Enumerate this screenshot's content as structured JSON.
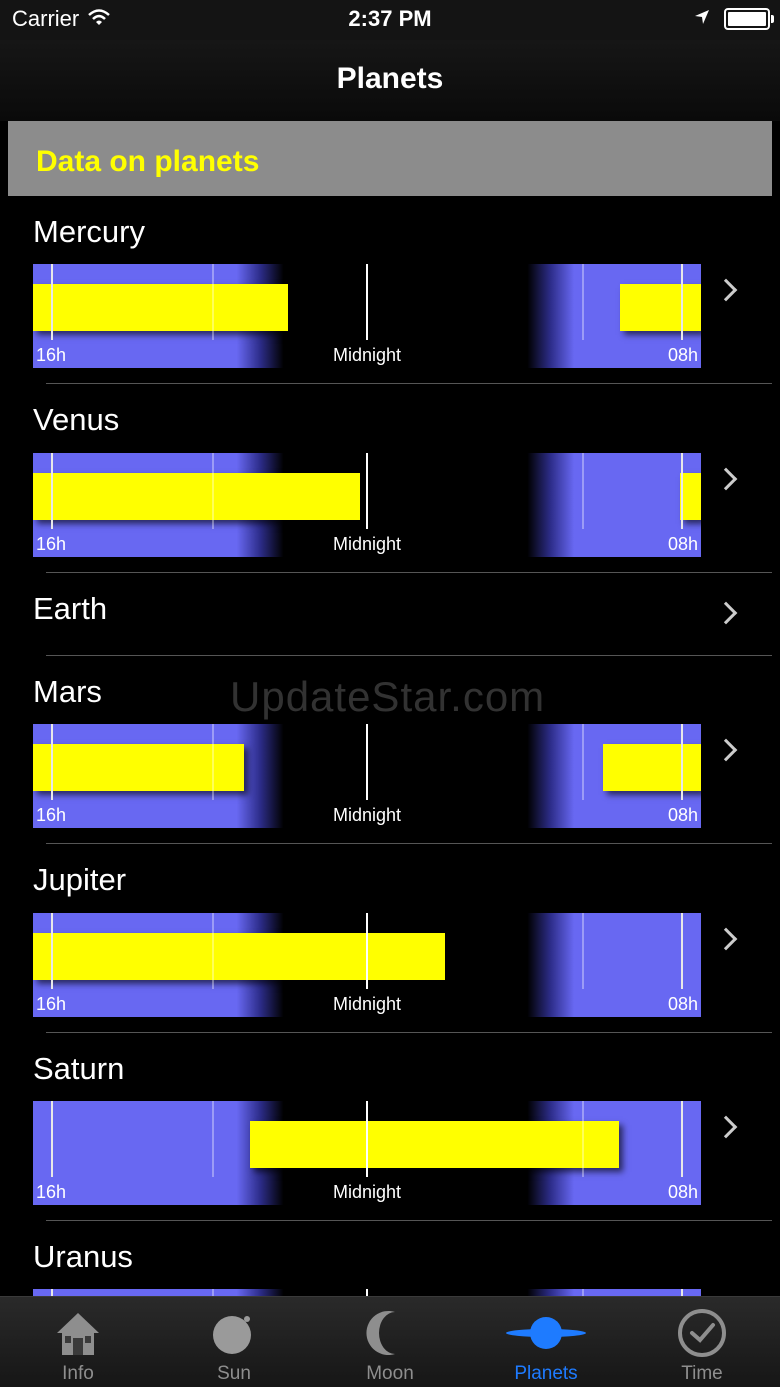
{
  "status_bar": {
    "carrier": "Carrier",
    "time": "2:37 PM"
  },
  "nav": {
    "title": "Planets"
  },
  "section": {
    "title": "Data on planets"
  },
  "timeline_labels": {
    "left": "16h",
    "middle": "Midnight",
    "right": "08h"
  },
  "colors": {
    "accent_yellow": "#ffff00",
    "sky_blue": "#6868f2",
    "tab_active": "#1e7bff"
  },
  "planets": [
    {
      "name": "Mercury",
      "has_chart": true,
      "visibility": [
        [
          0.0,
          0.382
        ],
        [
          0.878,
          1.0
        ]
      ]
    },
    {
      "name": "Venus",
      "has_chart": true,
      "visibility": [
        [
          0.0,
          0.49
        ],
        [
          0.969,
          1.0
        ]
      ]
    },
    {
      "name": "Earth",
      "has_chart": false,
      "visibility": []
    },
    {
      "name": "Mars",
      "has_chart": true,
      "visibility": [
        [
          0.0,
          0.316
        ],
        [
          0.853,
          1.0
        ]
      ]
    },
    {
      "name": "Jupiter",
      "has_chart": true,
      "visibility": [
        [
          0.0,
          0.617
        ]
      ]
    },
    {
      "name": "Saturn",
      "has_chart": true,
      "visibility": [
        [
          0.325,
          0.878
        ]
      ]
    },
    {
      "name": "Uranus",
      "has_chart": true,
      "visibility": []
    }
  ],
  "watermark": "UpdateStar.com",
  "tabs": [
    {
      "label": "Info",
      "icon": "house-icon",
      "active": false
    },
    {
      "label": "Sun",
      "icon": "sun-icon",
      "active": false
    },
    {
      "label": "Moon",
      "icon": "moon-icon",
      "active": false
    },
    {
      "label": "Planets",
      "icon": "planet-icon",
      "active": true
    },
    {
      "label": "Time",
      "icon": "clock-icon",
      "active": false
    }
  ]
}
